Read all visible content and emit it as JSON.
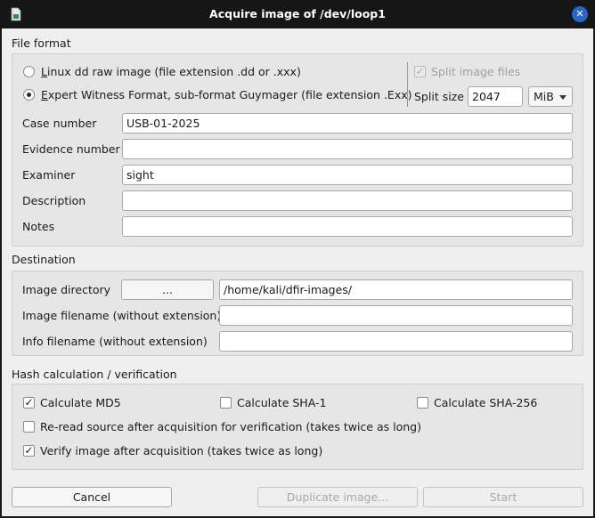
{
  "window": {
    "title": "Acquire image of /dev/loop1",
    "close_glyph": "✕",
    "app_icon": "document-icon"
  },
  "file_format": {
    "section_title": "File format",
    "option_dd": {
      "mnemonic": "L",
      "rest": "inux dd raw image (file extension .dd or .xxx)",
      "selected": false
    },
    "option_ewf": {
      "mnemonic": "E",
      "rest": "xpert Witness Format, sub-format Guymager (file extension .Exx)",
      "selected": true
    },
    "split_files": {
      "label": "Split image files",
      "checked": true,
      "enabled": false
    },
    "split_size": {
      "label": "Split size",
      "value": "2047",
      "unit": "MiB"
    },
    "fields": {
      "case_number": {
        "label": "Case number",
        "value": "USB-01-2025"
      },
      "evidence_number": {
        "label": "Evidence number",
        "value": ""
      },
      "examiner": {
        "label": "Examiner",
        "value": "sight"
      },
      "description": {
        "label": "Description",
        "value": ""
      },
      "notes": {
        "label": "Notes",
        "value": ""
      }
    }
  },
  "destination": {
    "section_title": "Destination",
    "image_directory": {
      "label": "Image directory",
      "browse_label": "...",
      "value": "/home/kali/dfir-images/"
    },
    "image_filename": {
      "label": "Image filename (without extension)",
      "value": ""
    },
    "info_filename": {
      "label": "Info filename (without extension)",
      "value": ""
    }
  },
  "hash": {
    "section_title": "Hash calculation / verification",
    "md5": {
      "label": "Calculate MD5",
      "checked": true
    },
    "sha1": {
      "label": "Calculate SHA-1",
      "checked": false
    },
    "sha256": {
      "label": "Calculate SHA-256",
      "checked": false
    },
    "reread": {
      "label": "Re-read source after acquisition for verification (takes twice as long)",
      "checked": false
    },
    "verify": {
      "label": "Verify image after acquisition (takes twice as long)",
      "checked": true
    }
  },
  "buttons": {
    "cancel": "Cancel",
    "duplicate": "Duplicate image...",
    "start": "Start"
  },
  "colors": {
    "titlebar": "#161616",
    "dialog_bg": "#efefef",
    "group_bg": "#e6e6e6",
    "close_button": "#2a66c8"
  }
}
